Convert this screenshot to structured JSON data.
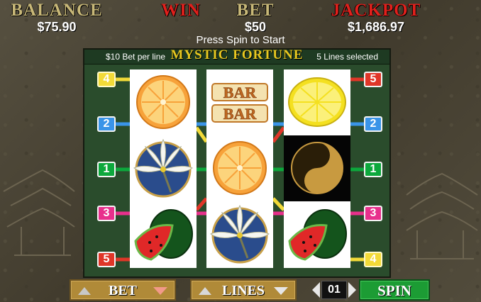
{
  "header": {
    "balance": {
      "label": "BALANCE",
      "value": "$75.90"
    },
    "win": {
      "label": "WIN",
      "value": ""
    },
    "bet": {
      "label": "BET",
      "value": "$50"
    },
    "jackpot": {
      "label": "JACKPOT",
      "value": "$1,686.97"
    }
  },
  "message": "Press Spin to Start",
  "panel": {
    "bet_per_line": "$10 Bet per line",
    "title": "MYSTIC FORTUNE",
    "lines_selected": "5 Lines selected"
  },
  "reels": [
    [
      "orange",
      "lily",
      "watermelon"
    ],
    [
      "bar-bar",
      "orange",
      "lily"
    ],
    [
      "lemon",
      "yin-yang",
      "watermelon"
    ]
  ],
  "paylines": {
    "left": [
      "4",
      "2",
      "1",
      "3",
      "5"
    ],
    "right": [
      "5",
      "2",
      "1",
      "3",
      "4"
    ],
    "colors": {
      "1": "#0ca83c",
      "2": "#3a94e8",
      "3": "#e8308c",
      "4": "#f2da38",
      "5": "#e03628"
    }
  },
  "symbols": {
    "bar_text": "BAR"
  },
  "controls": {
    "bet_label": "BET",
    "lines_label": "LINES",
    "stepper_value": "01",
    "spin_label": "SPIN"
  }
}
